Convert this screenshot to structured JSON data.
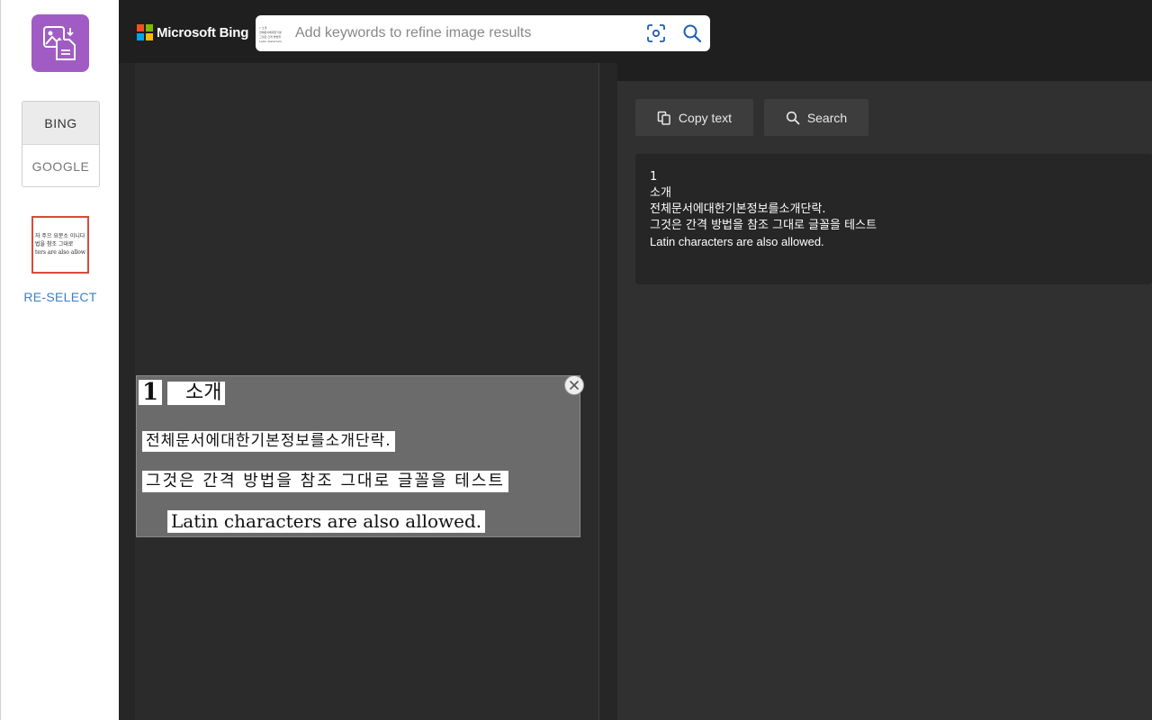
{
  "sidebar": {
    "engines": [
      {
        "label": "BING",
        "active": true
      },
      {
        "label": "GOOGLE",
        "active": false
      }
    ],
    "reselect_label": "RE-SELECT",
    "thumbnail_lines": [
      "자 주으 요문소 이니다",
      "법을 참조 그대로",
      "ters are also allow"
    ],
    "accent_color": "#a05cc4"
  },
  "header": {
    "brand": "Microsoft Bing",
    "search_placeholder": "Add keywords to refine image results",
    "search_value": "",
    "search_thumb_lines": [
      "1 소개",
      "전체문서에대한기본",
      "그것은 간격 방법을",
      "Latin characters"
    ]
  },
  "actions": {
    "copy_label": "Copy text",
    "search_label": "Search"
  },
  "preview": {
    "number": "1",
    "heading": "소개",
    "line1": "전체문서에대한기본정보를소개단락.",
    "line2": "그것은 간격 방법을 참조 그대로 글꼴을 테스트",
    "line3": "Latin characters are also allowed."
  },
  "result": {
    "lines": [
      "1",
      "소개",
      "전체문서에대한기본정보를소개단락.",
      "그것은 간격 방법을 참조 그대로 글꼴을 테스트",
      "Latin characters are also allowed."
    ]
  }
}
